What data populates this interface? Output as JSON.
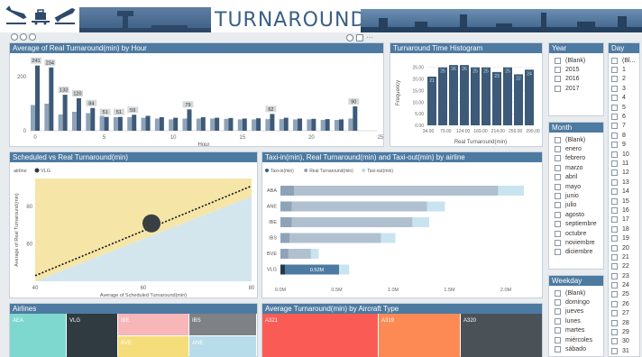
{
  "header": {
    "title": "TURNAROUND",
    "icons": [
      "plane-landing-icon",
      "luggage-cart-icon",
      "plane-takeoff-icon"
    ]
  },
  "toolbar": {
    "more": "···"
  },
  "colors": {
    "accent": "#4d7aa1",
    "bar": "#3d5a78",
    "bar_light": "#8fa3b8",
    "diag_yellow": "#f5e6a8",
    "diag_blue": "#d3e6ee"
  },
  "panels": {
    "by_hour": "Average of Real Turnaround(min) by Hour",
    "histogram": "Turnaround Time Histogram",
    "scatter": "Scheduled vs Real Turnaround(min)",
    "taxi": "Taxi-in(min), Real Turnaround(min) and Taxi-out(min) by airline",
    "airlines": "Airlines",
    "aircraft": "Average Turnaround(min) by Aircraft Type"
  },
  "chart_data": [
    {
      "type": "bar",
      "title": "Average of Real Turnaround(min) by Hour",
      "xlabel": "Hour",
      "x_ticks": [
        "0",
        "5",
        "10",
        "15",
        "20",
        "25"
      ],
      "y_ticks": [
        "0",
        "200"
      ],
      "ylim": [
        0,
        260
      ],
      "categories": [
        0,
        1,
        2,
        3,
        4,
        5,
        6,
        7,
        8,
        9,
        10,
        11,
        12,
        13,
        14,
        15,
        16,
        17,
        18,
        19,
        20,
        21,
        22,
        23
      ],
      "series": [
        {
          "values": [
            95,
            100,
            60,
            70,
            65,
            55,
            50,
            50,
            48,
            45,
            42,
            45,
            45,
            45,
            44,
            42,
            42,
            43,
            43,
            42,
            42,
            40,
            40,
            45
          ]
        },
        {
          "values": [
            241,
            234,
            133,
            120,
            84,
            51,
            51,
            59,
            55,
            50,
            48,
            79,
            50,
            48,
            47,
            45,
            46,
            62,
            48,
            45,
            44,
            43,
            42,
            90
          ]
        }
      ],
      "labels": [
        {
          "i": 0,
          "text": "241"
        },
        {
          "i": 1,
          "text": "234"
        },
        {
          "i": 2,
          "text": "133"
        },
        {
          "i": 3,
          "text": "120"
        },
        {
          "i": 4,
          "text": "84"
        },
        {
          "i": 5,
          "text": "51"
        },
        {
          "i": 6,
          "text": "51"
        },
        {
          "i": 7,
          "text": "59"
        },
        {
          "i": 11,
          "text": "79"
        },
        {
          "i": 17,
          "text": "62"
        },
        {
          "i": 23,
          "text": "90"
        }
      ]
    },
    {
      "type": "bar",
      "title": "Turnaround Time Histogram",
      "xlabel": "Real Turnaround(min)",
      "ylabel": "Frequency",
      "x_ticks": [
        "34.00",
        "79.00",
        "124.00",
        "169.00",
        "214.00",
        "259.00",
        "299.00"
      ],
      "y_ticks": [
        "0.00",
        "5.00",
        "10.00",
        "15.00",
        "20.00",
        "25.00"
      ],
      "ylim": [
        0,
        28
      ],
      "values": [
        21,
        25,
        26,
        26,
        25,
        25,
        23,
        25,
        22,
        24
      ],
      "value_labels": [
        "21",
        "25",
        "26",
        "26",
        "25",
        "25",
        "23",
        "25",
        "22",
        "24"
      ]
    },
    {
      "type": "scatter",
      "title": "Scheduled vs Real Turnaround(min)",
      "xlabel": "Average of Scheduled Turnaround(min)",
      "ylabel": "Average of Real Turnaround(min)",
      "xlim": [
        40,
        80
      ],
      "ylim": [
        40,
        95
      ],
      "x_ticks": [
        "40",
        "60",
        "80"
      ],
      "y_ticks": [
        "60",
        "80"
      ],
      "legend_title": "airline",
      "legend": [
        "VLG"
      ],
      "points": [
        {
          "x": 61.5,
          "y": 71,
          "label": "VLG"
        }
      ],
      "trend": [
        {
          "x": 40,
          "y": 43
        },
        {
          "x": 80,
          "y": 91
        }
      ]
    },
    {
      "type": "bar",
      "title": "Taxi-in(min), Real Turnaround(min) and Taxi-out(min) by airline",
      "legend": [
        "Taxi-in(min)",
        "Real Turnaround(min)",
        "Taxi-out(min)"
      ],
      "categories": [
        "ABA",
        "ANE",
        "IBE",
        "IBS",
        "BVE",
        "VLG"
      ],
      "x_ticks": [
        "0.0M",
        "0.5M",
        "1.0M",
        "1.5M",
        "2.0M"
      ],
      "xlim": [
        0,
        2.2
      ],
      "series": [
        {
          "name": "Taxi-in(min)",
          "values": [
            0.12,
            0.1,
            0.1,
            0.08,
            0.07,
            0.04
          ]
        },
        {
          "name": "Real Turnaround(min)",
          "values": [
            1.93,
            1.3,
            1.17,
            0.89,
            0.27,
            0.52
          ]
        },
        {
          "name": "Taxi-out(min)",
          "values": [
            0.23,
            0.16,
            0.15,
            0.13,
            0.07,
            0.09
          ]
        }
      ],
      "data_labels": [
        {
          "i": 5,
          "text": "0.52M"
        }
      ]
    }
  ],
  "airlines_treemap": [
    {
      "label": "AEA",
      "color": "#7fd8cf"
    },
    {
      "label": "VLG",
      "color": "#2f3b40"
    },
    {
      "label": "IBE",
      "color": "#f8b6b8"
    },
    {
      "label": "IBS",
      "color": "#7e8286"
    },
    {
      "label": "BVE",
      "color": "#f4dd7a"
    },
    {
      "label": "ANE",
      "color": "#b9dcea"
    }
  ],
  "aircraft_treemap": [
    {
      "label": "A321",
      "color": "#fb5b55"
    },
    {
      "label": "A319",
      "color": "#fd8a55"
    },
    {
      "label": "A320",
      "color": "#4a5257"
    }
  ],
  "slicers": {
    "year": {
      "title": "Year",
      "items": [
        "(Blank)",
        "2015",
        "2016",
        "2017"
      ]
    },
    "month": {
      "title": "Month",
      "items": [
        "(Blank)",
        "enero",
        "febrero",
        "marzo",
        "abril",
        "mayo",
        "junio",
        "julio",
        "agosto",
        "septiembre",
        "octubre",
        "noviembre",
        "diciembre"
      ]
    },
    "weekday": {
      "title": "Weekday",
      "items": [
        "(Blank)",
        "domingo",
        "jueves",
        "lunes",
        "martes",
        "miércoles",
        "sábado"
      ]
    },
    "day": {
      "title": "Day",
      "items": [
        "(Bl...",
        "1",
        "2",
        "3",
        "4",
        "5",
        "6",
        "7",
        "8",
        "9",
        "10",
        "11",
        "12",
        "13",
        "14",
        "15",
        "16",
        "17",
        "18",
        "19",
        "20",
        "21",
        "22",
        "23",
        "24",
        "25",
        "26",
        "27",
        "28",
        "29",
        "30",
        "31"
      ]
    }
  }
}
